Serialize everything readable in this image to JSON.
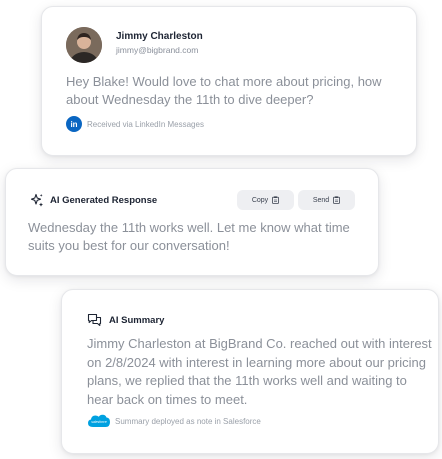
{
  "message_card": {
    "sender_name": "Jimmy Charleston",
    "sender_email": "jimmy@bigbrand.com",
    "message": "Hey Blake! Would love to chat more about pricing, how about Wednesday the 11th to dive deeper?",
    "source_icon": "linkedin-icon",
    "source_icon_glyph": "in",
    "source_text": "Received via LinkedIn Messages"
  },
  "response_card": {
    "title": "AI Generated Response",
    "title_icon": "sparkle-icon",
    "copy_label": "Copy",
    "send_label": "Send",
    "response": "Wednesday the 11th works well. Let me know what time suits you best for our conversation!"
  },
  "summary_card": {
    "title": "AI Summary",
    "title_icon": "chat-bubbles-icon",
    "summary": "Jimmy Charleston at BigBrand Co. reached out with interest on 2/8/2024 with interest in learning more about our pricing plans, we replied that the 11th works well and waiting to hear back on times to meet.",
    "source_icon": "salesforce-icon",
    "source_icon_text": "salesforce",
    "source_text": "Summary deployed as note in Salesforce"
  },
  "colors": {
    "linkedin": "#0a66c2",
    "salesforce": "#00a1e0",
    "heading": "#1d2433",
    "body_text": "#8b9099",
    "button_bg": "#eeeff2"
  }
}
